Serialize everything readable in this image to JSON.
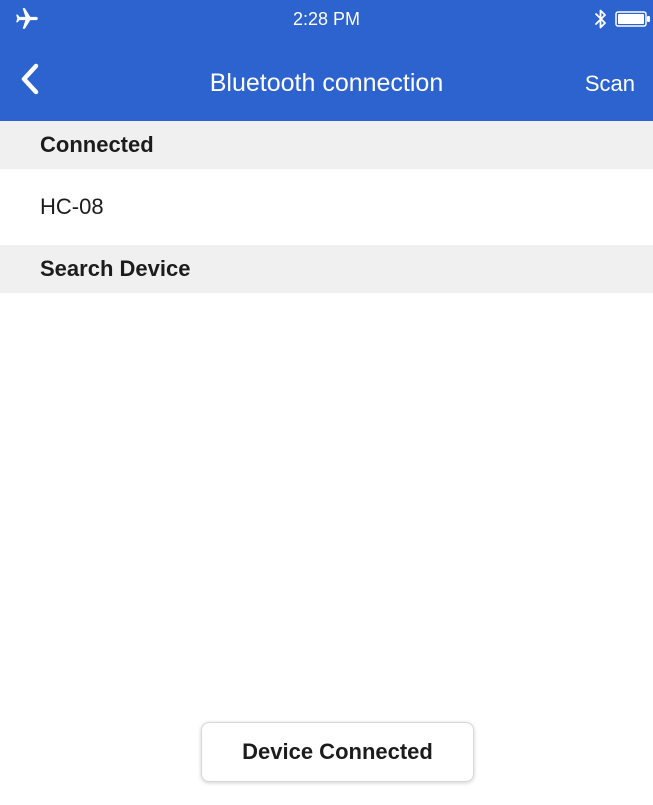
{
  "status_bar": {
    "time": "2:28 PM",
    "airplane_icon": "airplane-icon",
    "bluetooth_icon": "bluetooth-icon",
    "battery_icon": "battery-icon"
  },
  "nav": {
    "back_icon": "chevron-left-icon",
    "title": "Bluetooth connection",
    "scan_label": "Scan"
  },
  "sections": {
    "connected_header": "Connected",
    "search_header": "Search Device"
  },
  "connected_devices": [
    {
      "name": "HC-08"
    }
  ],
  "toast": {
    "message": "Device Connected"
  },
  "colors": {
    "nav_blue": "#2d63cf",
    "section_bg": "#f0f0f0",
    "text": "#1c1c1c"
  }
}
